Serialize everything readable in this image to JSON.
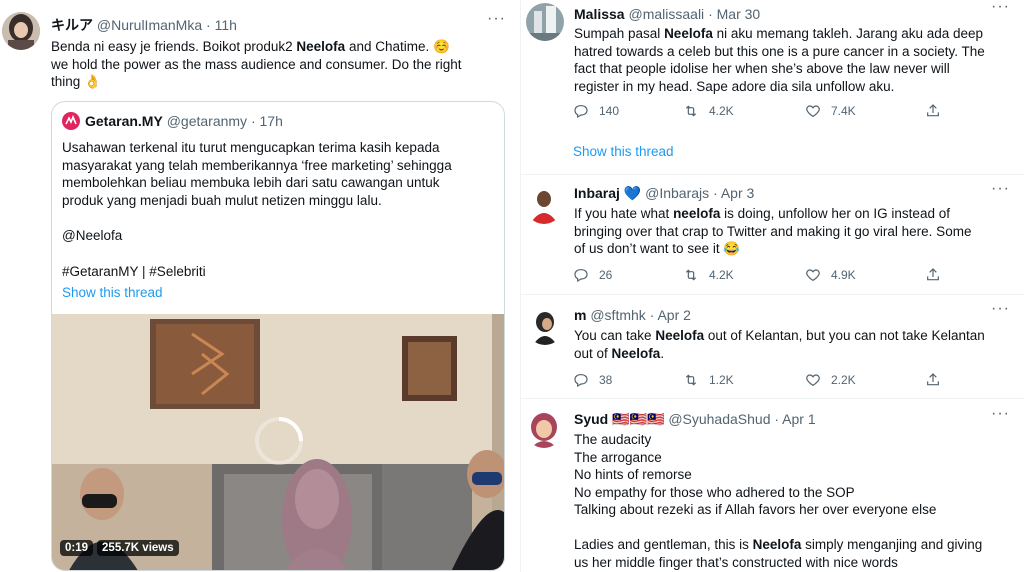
{
  "left_tweet": {
    "display_name": "キルア",
    "handle": "@NurulImanMka",
    "time": "11h",
    "text_lines": [
      "Benda ni easy je friends. Boikot produk2 Neelofa and Chatime. ☺️",
      "we hold the power as the mass audience and consumer. Do the right",
      "thing 👌"
    ],
    "quote": {
      "display_name": "Getaran.MY",
      "handle": "@getaranmy",
      "time": "17h",
      "lines": [
        "Usahawan terkenal itu turut mengucapkan terima kasih kepada",
        "masyarakat yang telah memberikannya ‘free marketing’ sehingga",
        "membolehkan beliau membuka lebih dari satu cawangan untuk",
        "produk yang menjadi buah mulut netizen minggu lalu.",
        "@Neelofa",
        "#GetaranMY | #Selebriti"
      ],
      "show_thread": "Show this thread",
      "video": {
        "duration": "0:19",
        "views": "255.7K views"
      }
    }
  },
  "right_tweets": [
    {
      "display_name": "Malissa",
      "handle": "@malissaali",
      "time": "Mar 30",
      "lines": [
        "Sumpah pasal Neelofa ni aku memang takleh. Jarang aku ada deep",
        "hatred towards a celeb but this one is a pure cancer in a society. The",
        "fact that people idolise her when she’s above the law never will",
        "register in my head. Sape adore dia sila unfollow aku."
      ],
      "replies": "140",
      "retweets": "4.2K",
      "likes": "7.4K",
      "show_thread": "Show this thread"
    },
    {
      "display_name": "Inbaraj",
      "handle": "@Inbarajs",
      "time": "Apr 3",
      "lines": [
        "If you hate what neelofa is doing, unfollow her on IG instead of",
        "bringing over that crap to Twitter and making it go viral here. Some",
        "of us don’t want to see it 😂"
      ],
      "replies": "26",
      "retweets": "4.2K",
      "likes": "4.9K"
    },
    {
      "display_name": "m",
      "handle": "@sftmhk",
      "time": "Apr 2",
      "lines": [
        "You can take Neelofa out of Kelantan, but you can not take Kelantan",
        "out of Neelofa."
      ],
      "replies": "38",
      "retweets": "1.2K",
      "likes": "2.2K"
    },
    {
      "display_name": "Syud",
      "display_name_flags": "🇲🇾🇲🇾🇲🇾",
      "handle": "@SyuhadaShud",
      "time": "Apr 1",
      "lines": [
        "The audacity",
        "The arrogance",
        "No hints of remorse",
        "No empathy for those who adhered to the SOP",
        "Talking about rezeki as if Allah favors her over everyone else",
        "Ladies and gentleman, this is Neelofa simply menganjing and giving",
        "us her middle finger that’s constructed with nice words"
      ]
    }
  ],
  "colors": {
    "text": "#0f1419",
    "secondary": "#536471",
    "link": "#1d9bf0",
    "verified": "#1d9bf0",
    "getaran_brand": "#e0245e"
  },
  "icons": [
    "reply-icon",
    "retweet-icon",
    "like-icon",
    "share-icon",
    "more-icon",
    "verified-heart-icon",
    "loading-spinner-icon"
  ]
}
